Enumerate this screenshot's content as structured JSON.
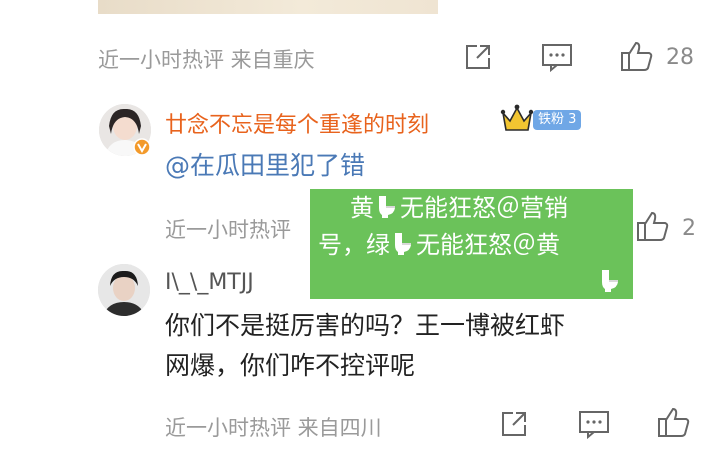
{
  "top_meta": {
    "text": "近一小时热评  来自重庆",
    "like_count": "28"
  },
  "comment1": {
    "username": "廿念不忘是每个重逢的时刻",
    "badge": "铁粉 3",
    "text": "@在瓜田里犯了错",
    "meta_text": "近一小时热评",
    "like_count": "2"
  },
  "comment2": {
    "username": "I\\_\\_MTJJ",
    "text_line1": "你们不是挺厉害的吗？王一博被红虾",
    "text_line2": "网爆，你们咋不控评呢",
    "meta_text": "近一小时热评  来自四川"
  },
  "overlay": {
    "line1_a": "黄",
    "line1_b": "无能狂怒＠营销",
    "line2_a": "号，绿",
    "line2_b": "无能狂怒＠黄",
    "toilet_icon": "toilet-icon"
  },
  "colors": {
    "username_orange": "#e8631d",
    "mention_blue": "#4a79b6",
    "meta_gray": "#9a9a9a",
    "overlay_green": "#6bc25a",
    "badge_blue": "#6fa7e6"
  }
}
